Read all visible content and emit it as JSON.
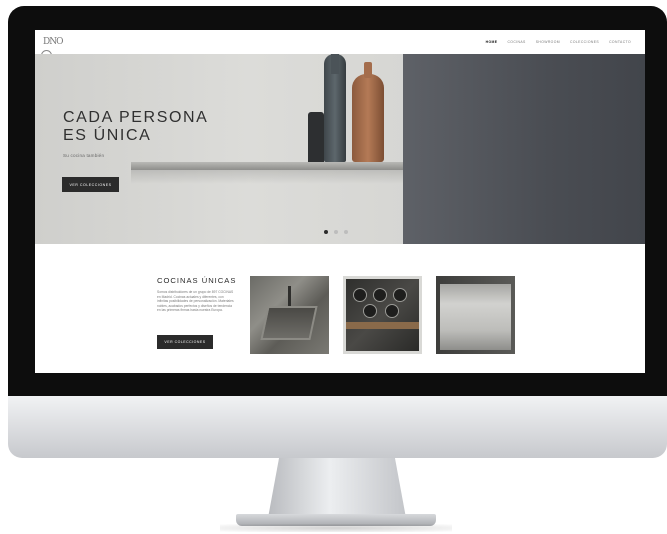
{
  "nav": {
    "logo_text": "DNO",
    "items": [
      {
        "label": "Home",
        "active": true
      },
      {
        "label": "Cocinas",
        "active": false
      },
      {
        "label": "Showroom",
        "active": false
      },
      {
        "label": "Colecciones",
        "active": false
      },
      {
        "label": "Contacto",
        "active": false
      }
    ]
  },
  "hero": {
    "title_line1": "CADA PERSONA",
    "title_line2": "ES ÚNICA",
    "subtitle": "Su cocina también",
    "button_label": "VER COLECCIONES",
    "slides_total": 3,
    "slide_active": 1
  },
  "collection": {
    "title": "COCINAS ÚNICAS",
    "text": "Somos distribuidores de un grupo de 897 COCINAS en Madrid. Cocinas actuales y diferentes, con infinitas posibilidades de personalización. Materiales nobles, acabados perfectos y diseños de tendencia en las primeras firmas hasta nuestra Europa.",
    "button_label": "VER COLECCIONES"
  },
  "colors": {
    "bezel": "#0d0d0d",
    "button": "#2b2b2b",
    "title": "#303030",
    "panel": "#4a4d53",
    "copper_vase": "#b47a56"
  }
}
